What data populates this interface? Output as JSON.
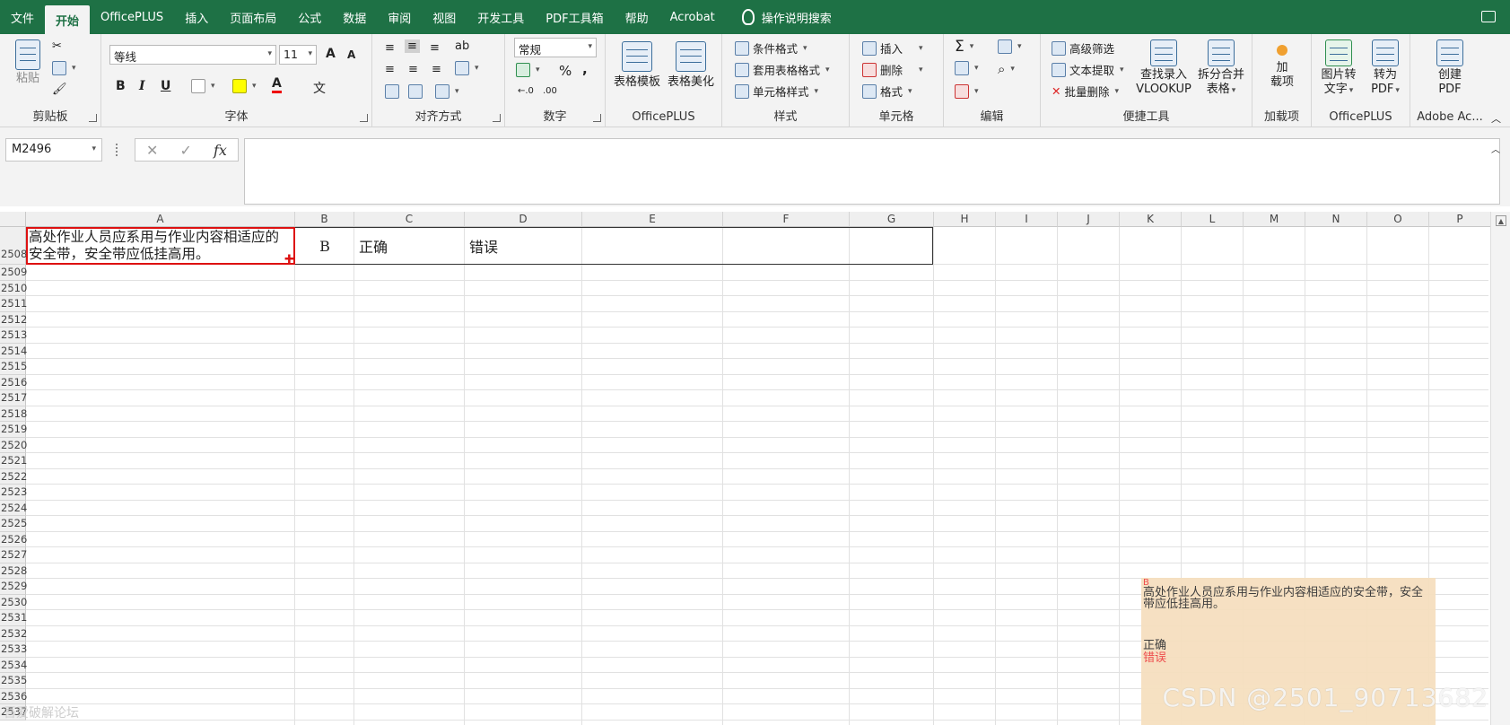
{
  "tabs": [
    "文件",
    "开始",
    "OfficePLUS",
    "插入",
    "页面布局",
    "公式",
    "数据",
    "审阅",
    "视图",
    "开发工具",
    "PDF工具箱",
    "帮助",
    "Acrobat"
  ],
  "active_tab": "开始",
  "tell_me": "操作说明搜索",
  "ribbon": {
    "clipboard": {
      "paste": "粘贴",
      "label": "剪贴板"
    },
    "font": {
      "name": "等线",
      "size": "11",
      "bold": "B",
      "italic": "I",
      "underline": "U",
      "grow": "A",
      "shrink": "A",
      "color_a": "A",
      "wen": "文",
      "label": "字体"
    },
    "align": {
      "label": "对齐方式"
    },
    "number": {
      "format": "常规",
      "percent": "%",
      "comma": ",",
      "label": "数字"
    },
    "officeplus": {
      "tpl": "表格模板",
      "beautify": "表格美化",
      "label": "OfficePLUS"
    },
    "styles": {
      "cond": "条件格式",
      "table": "套用表格格式",
      "cell": "单元格样式",
      "label": "样式"
    },
    "cells": {
      "insert": "插入",
      "delete": "删除",
      "format": "格式",
      "label": "单元格"
    },
    "edit": {
      "label": "编辑",
      "sigma": "Σ"
    },
    "quick": {
      "adv_filter": "高级筛选",
      "text_extract": "文本提取",
      "batch_delete": "批量删除",
      "lookup1": "查找录入",
      "lookup2": "VLOOKUP",
      "split1": "拆分合并",
      "split2": "表格",
      "label": "便捷工具"
    },
    "addins": {
      "l1": "加",
      "l2": "载项",
      "label": "加载项"
    },
    "oplus2": {
      "img1": "图片转",
      "img2": "文字",
      "pdf1": "转为",
      "pdf2": "PDF",
      "label": "OfficePLUS"
    },
    "adobe": {
      "l1": "创建",
      "l2": "PDF",
      "label": "Adobe Ac..."
    }
  },
  "name_box": "M2496",
  "columns": [
    "A",
    "B",
    "C",
    "D",
    "E",
    "F",
    "G",
    "H",
    "I",
    "J",
    "K",
    "L",
    "M",
    "N",
    "O",
    "P"
  ],
  "rows": [
    "2508",
    "2509",
    "2510",
    "2511",
    "2512",
    "2513",
    "2514",
    "2515",
    "2516",
    "2517",
    "2518",
    "2519",
    "2520",
    "2521",
    "2522",
    "2523",
    "2524",
    "2525",
    "2526",
    "2527",
    "2528",
    "2529",
    "2530",
    "2531",
    "2532",
    "2533",
    "2534",
    "2535",
    "2536",
    "2537"
  ],
  "cells": {
    "A2508": "高处作业人员应系用与作业内容相适应的安全带，安全带应低挂高用。",
    "B2508": "B",
    "C2508": "正确",
    "D2508": "错误"
  },
  "overlay": {
    "answer": "B",
    "question": "高处作业人员应系用与作业内容相适应的安全带，安全带应低挂高用。",
    "option1": "正确",
    "option2": "错误"
  },
  "watermark": "CSDN @2501_90713682",
  "watermark2": "吾爱破解论坛"
}
